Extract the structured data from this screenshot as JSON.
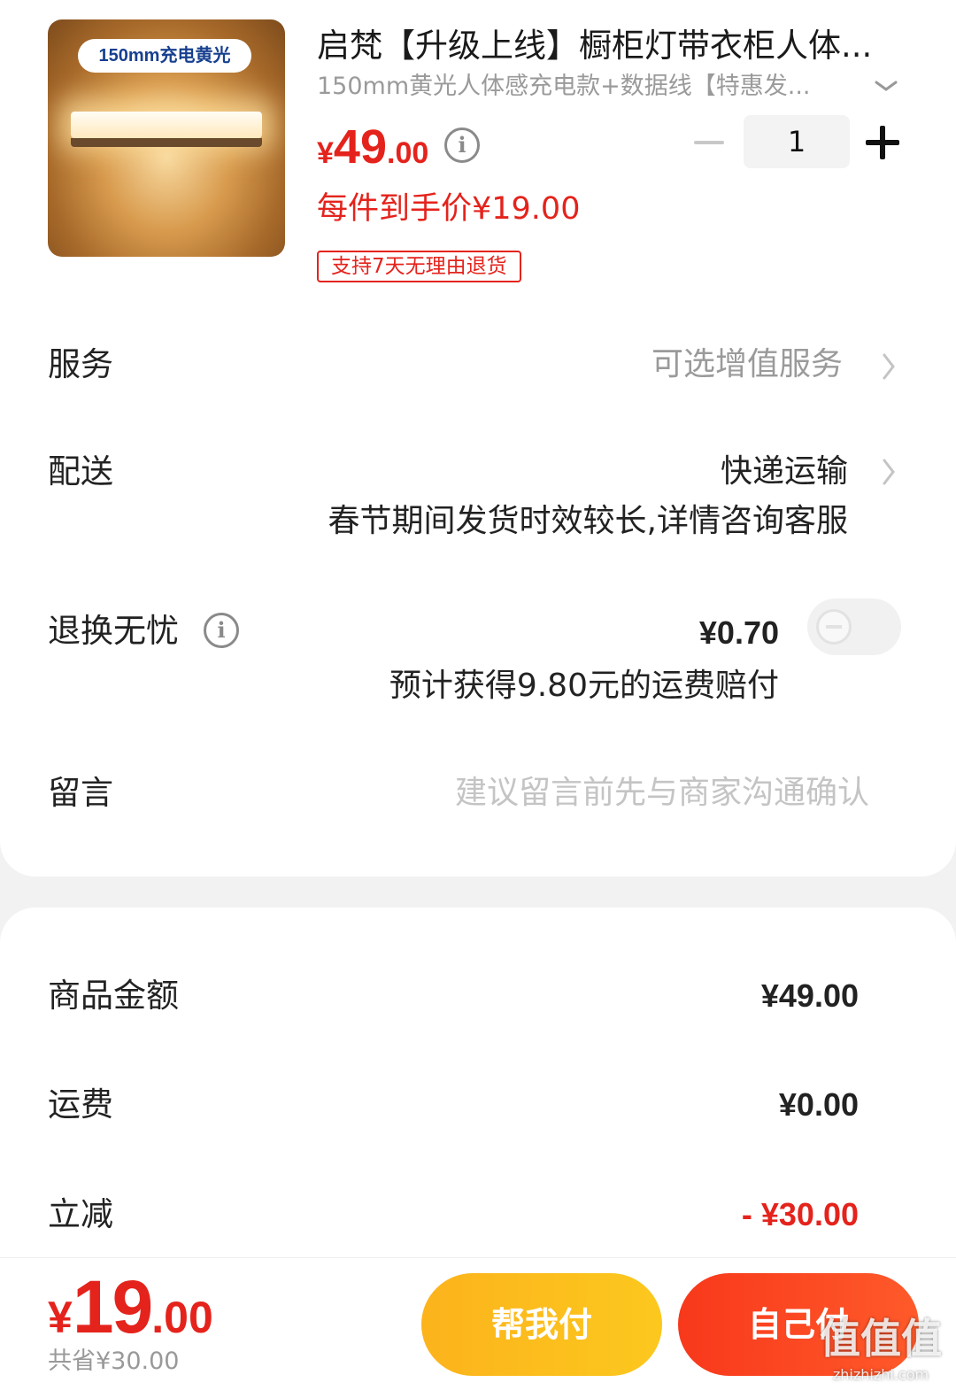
{
  "product": {
    "image_badge": "150mm充电黄光",
    "title": "启梵【升级上线】橱柜灯带衣柜人体...",
    "spec": "150mm黄光人体感充电款+数据线【特惠发...",
    "price_symbol": "¥",
    "price_int": "49",
    "price_dec": ".00",
    "quantity": "1",
    "unit_price": "每件到手价¥19.00",
    "return_policy": "支持7天无理由退货"
  },
  "rows": {
    "service_label": "服务",
    "service_value": "可选增值服务",
    "delivery_label": "配送",
    "delivery_value": "快递运输",
    "delivery_note": "春节期间发货时效较长,详情咨询客服",
    "return_label": "退换无忧",
    "return_value": "¥0.70",
    "return_note": "预计获得9.80元的运费赔付",
    "message_label": "留言",
    "message_placeholder": "建议留言前先与商家沟通确认"
  },
  "summary": {
    "goods_label": "商品金额",
    "goods_value": "¥49.00",
    "shipping_label": "运费",
    "shipping_value": "¥0.00",
    "discount_label": "立减",
    "discount_value": "- ¥30.00"
  },
  "footer": {
    "total_symbol": "¥",
    "total_int": "19",
    "total_dec": ".00",
    "saved": "共省¥30.00",
    "help_pay_label": "帮我付",
    "self_pay_label": "自己付"
  },
  "watermark": {
    "text": "值值值",
    "sub": "zhizhizhi.com"
  },
  "colors": {
    "accent_red": "#e4231c",
    "button_yellow": "#fcb31c",
    "button_red": "#f8381b"
  },
  "icons": [
    "chevron-down-icon",
    "info-icon",
    "minus-icon",
    "plus-icon",
    "chevron-right-icon",
    "toggle-switch"
  ]
}
